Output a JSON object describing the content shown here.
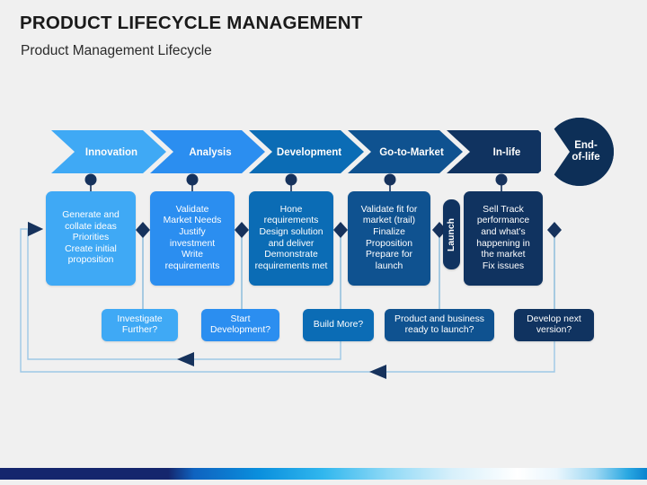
{
  "header": {
    "title": "PRODUCT LIFECYCLE MANAGEMENT",
    "subtitle": "Product Management Lifecycle"
  },
  "colors": {
    "stage_1": "#3fa9f5",
    "stage_2": "#2b8ef0",
    "stage_3": "#0b6cb5",
    "stage_4": "#0f5290",
    "stage_5": "#103360",
    "stage_6": "#0d2f57",
    "connector_dot": "#16325c",
    "diamond": "#16325c",
    "loop_line": "#9dc8e6",
    "loop_arrow": "#16325c",
    "background": "#f0f0f0"
  },
  "stages": [
    {
      "name": "Innovation",
      "color": "#3fa9f5",
      "description": "Generate and collate ideas Priorities Create initial proposition",
      "description_lines": [
        "Generate and",
        "collate ideas",
        "Priorities",
        "Create initial",
        "proposition"
      ],
      "decision": "Investigate Further?",
      "decision_lines": [
        "Investigate",
        "Further?"
      ]
    },
    {
      "name": "Analysis",
      "color": "#2b8ef0",
      "description": "Validate Market Needs Justify investment Write requirements",
      "description_lines": [
        "Validate",
        "Market Needs",
        "Justify",
        "investment",
        "Write",
        "requirements"
      ],
      "decision": "Start Development?",
      "decision_lines": [
        "Start",
        "Development?"
      ]
    },
    {
      "name": "Development",
      "color": "#0b6cb5",
      "description": "Hone requirements Design solution and deliver Demonstrate requirements met",
      "description_lines": [
        "Hone",
        "requirements",
        "Design solution",
        "and deliver",
        "Demonstrate",
        "requirements met"
      ],
      "decision": "Build More?",
      "decision_lines": [
        "Build More?"
      ]
    },
    {
      "name": "Go-to-Market",
      "color": "#0f5290",
      "description": "Validate fit for market (trail) Finalize Proposition Prepare for launch",
      "description_lines": [
        "Validate fit for",
        "market (trail)",
        "Finalize",
        "Proposition",
        "Prepare for",
        "launch"
      ],
      "decision": "Product and business ready to launch?",
      "decision_lines": [
        "Product and business",
        "ready to launch?"
      ]
    },
    {
      "name": "In-life",
      "color": "#103360",
      "description": "Sell Track performance and what’s happening in the market Fix issues",
      "description_lines": [
        "Sell Track",
        "performance",
        "and what’s",
        "happening in",
        "the market",
        "Fix issues"
      ],
      "decision": "Develop next version?",
      "decision_lines": [
        "Develop next",
        "version?"
      ]
    },
    {
      "name": "End-of-life",
      "color": "#0d2f57",
      "name_lines": [
        "End-",
        "of-life"
      ],
      "description": "",
      "decision": ""
    }
  ],
  "gate": {
    "label": "Launch"
  },
  "feedback_loops": [
    {
      "name": "inner-loop",
      "from_stage": "Build More?",
      "to_stage": "Innovation"
    },
    {
      "name": "outer-loop",
      "from_stage": "Develop next version?",
      "to_stage": "Innovation"
    }
  ]
}
